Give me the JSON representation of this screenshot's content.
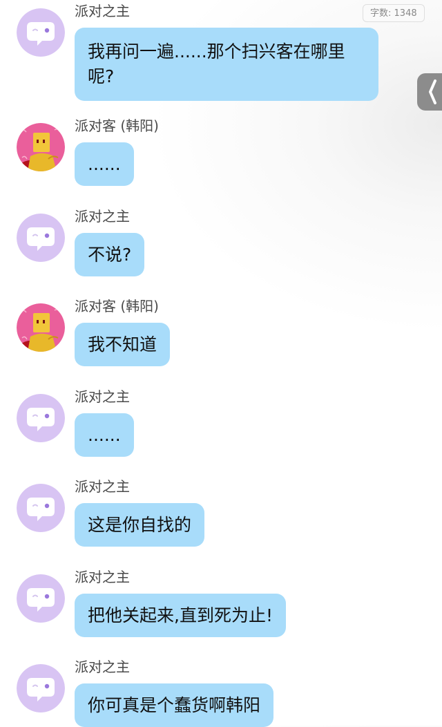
{
  "word_count": {
    "label": "字数:",
    "value": "1348"
  },
  "messages": [
    {
      "sender": "派对之主",
      "avatar": "chat-bubble-avatar",
      "text": "我再问一遍......那个扫兴客在哪里呢?"
    },
    {
      "sender": "派对客 (韩阳)",
      "avatar": "yellow-character-avatar",
      "text": "......"
    },
    {
      "sender": "派对之主",
      "avatar": "chat-bubble-avatar",
      "text": "不说?"
    },
    {
      "sender": "派对客 (韩阳)",
      "avatar": "yellow-character-avatar",
      "text": "我不知道"
    },
    {
      "sender": "派对之主",
      "avatar": "chat-bubble-avatar",
      "text": "......"
    },
    {
      "sender": "派对之主",
      "avatar": "chat-bubble-avatar",
      "text": "这是你自找的"
    },
    {
      "sender": "派对之主",
      "avatar": "chat-bubble-avatar",
      "text": "把他关起来,直到死为止!"
    },
    {
      "sender": "派对之主",
      "avatar": "chat-bubble-avatar",
      "text": "你可真是个蠢货啊韩阳"
    }
  ],
  "side_tab": {
    "icon": "chevron-left-icon"
  },
  "colors": {
    "bubble": "#a8dcfa",
    "host_avatar_bg": "#d8c4f3",
    "guest_avatar_bg": "#ea5f9b",
    "side_tab": "#8c8c8c"
  }
}
